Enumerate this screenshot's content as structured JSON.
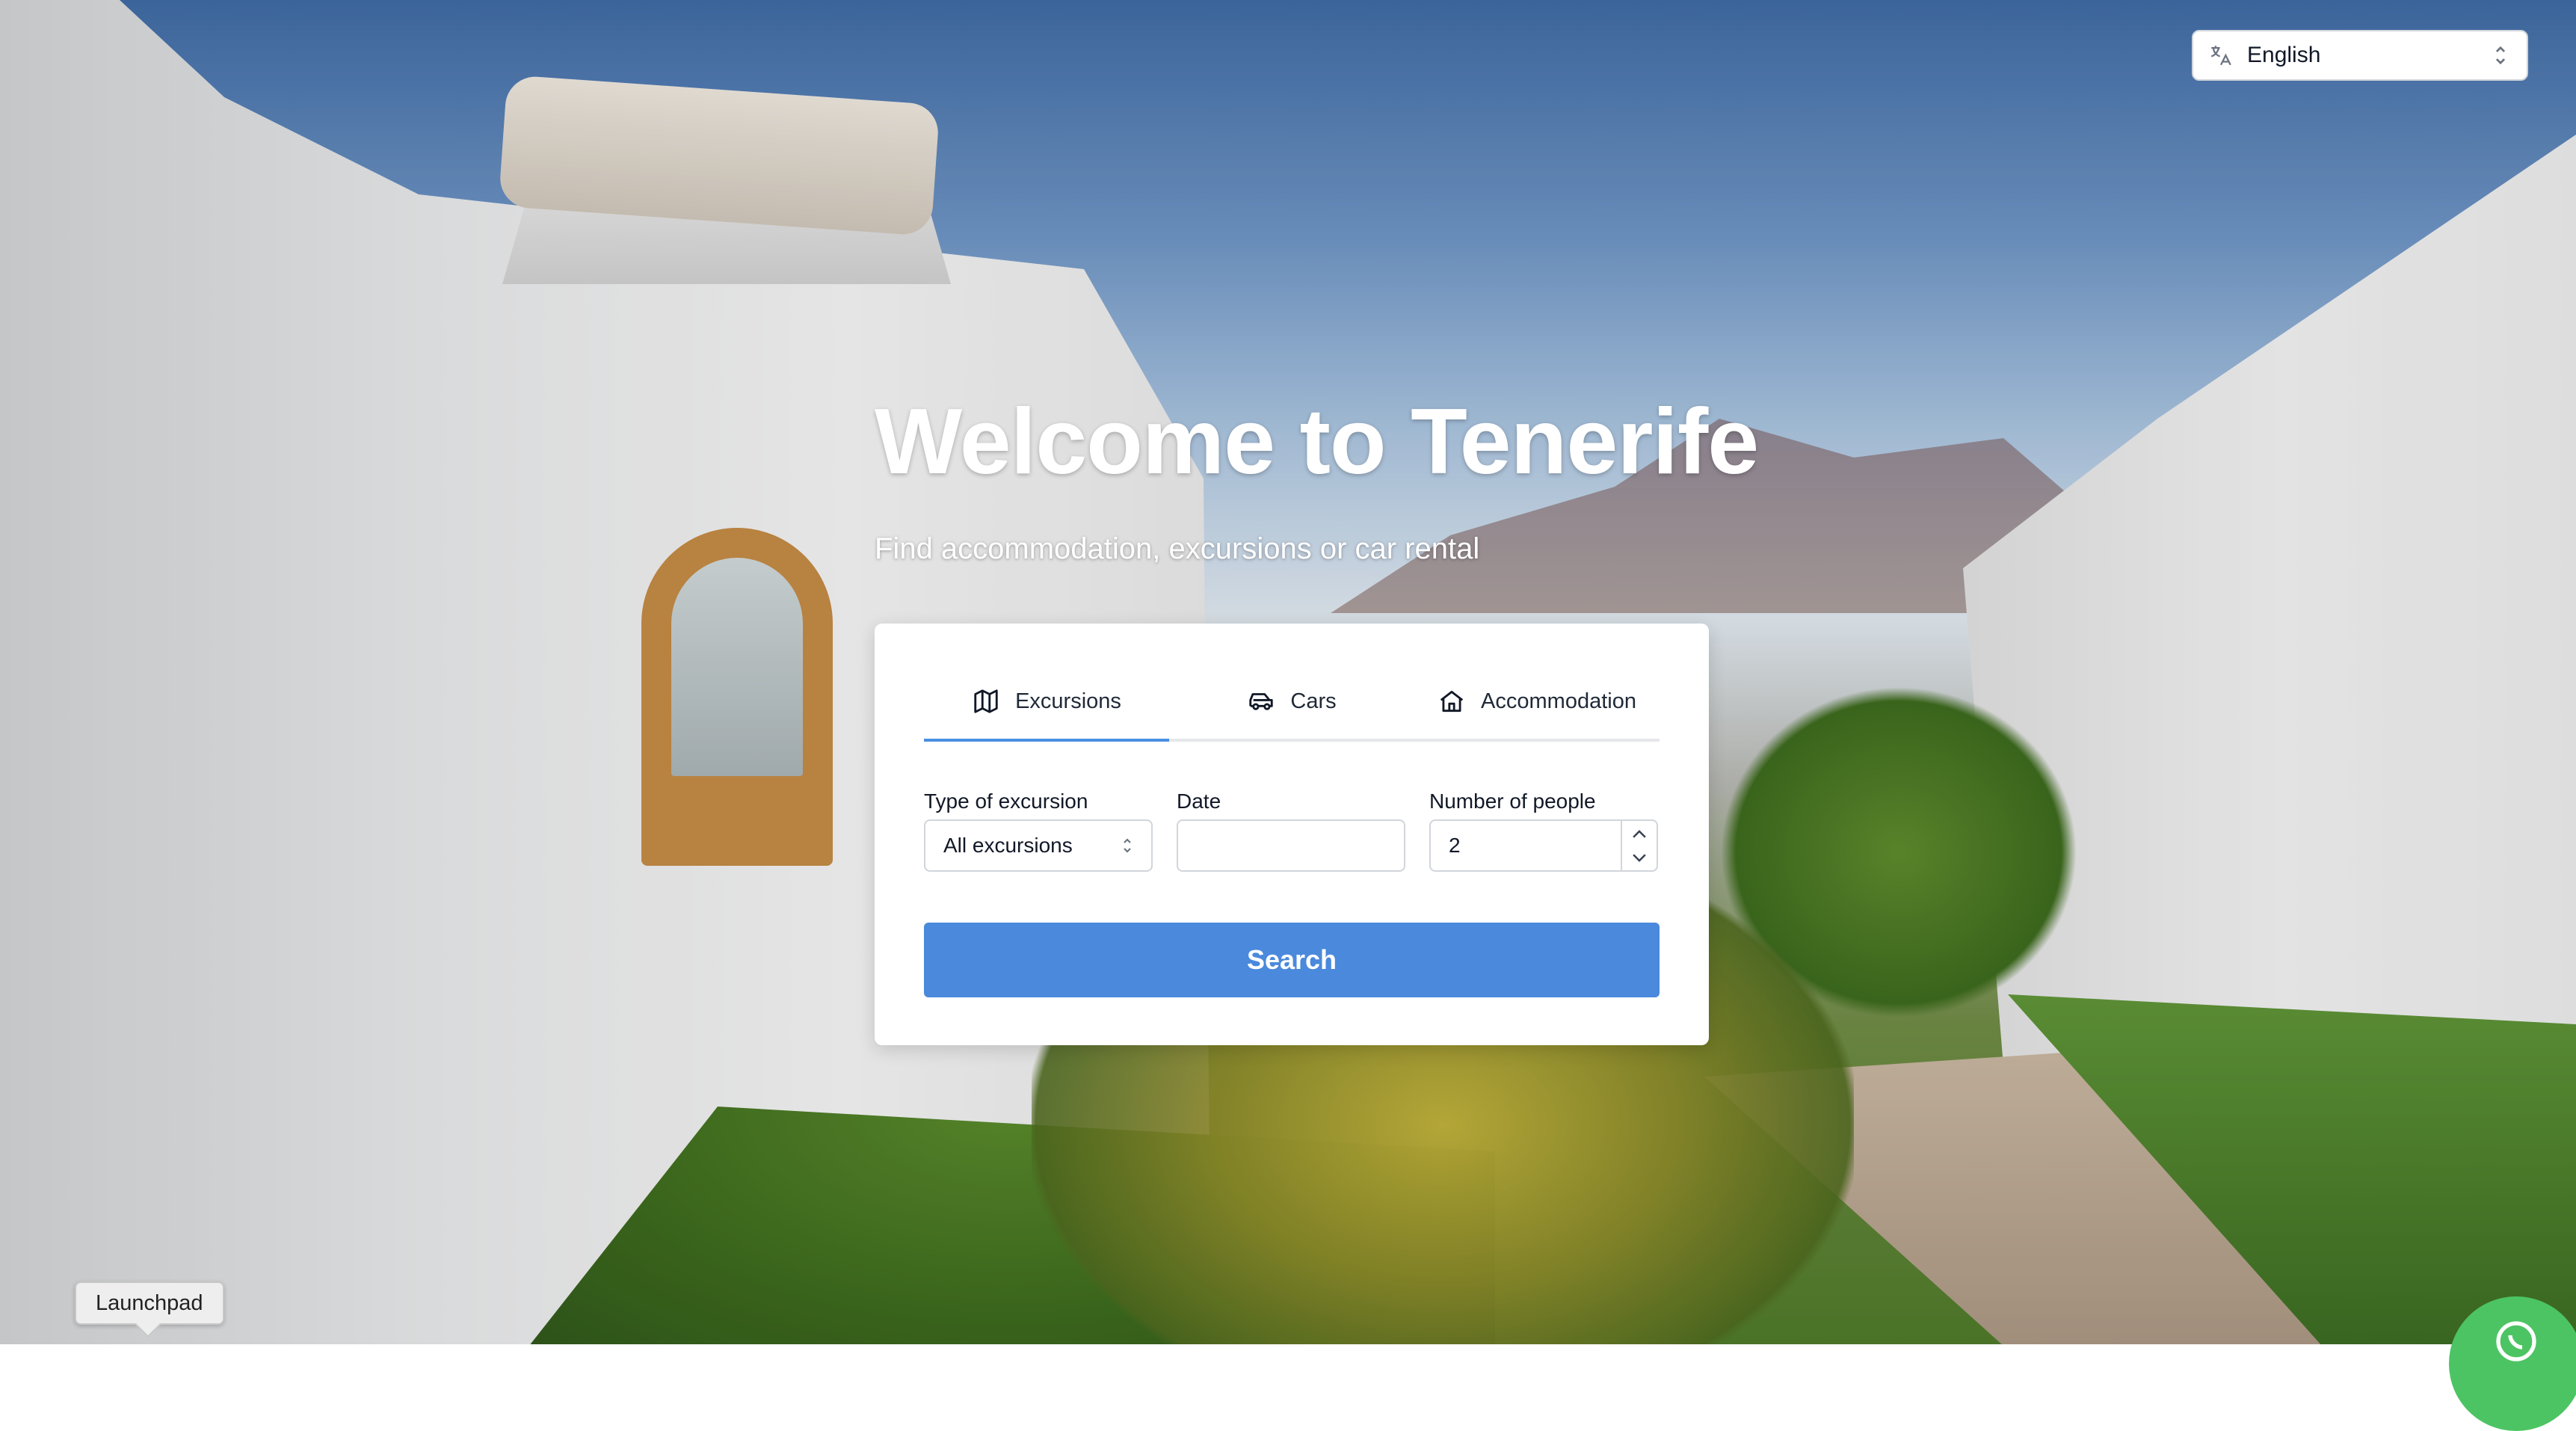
{
  "language": {
    "selected": "English"
  },
  "hero": {
    "title": "Welcome to Tenerife",
    "subtitle": "Find accommodation, excursions or car rental"
  },
  "tabs": [
    {
      "label": "Excursions",
      "icon": "map-icon",
      "active": true
    },
    {
      "label": "Cars",
      "icon": "car-icon",
      "active": false
    },
    {
      "label": "Accommodation",
      "icon": "home-icon",
      "active": false
    }
  ],
  "form": {
    "type_label": "Type of excursion",
    "type_value": "All excursions",
    "date_label": "Date",
    "date_value": "",
    "people_label": "Number of people",
    "people_value": "2",
    "search_label": "Search"
  },
  "launchpad": {
    "label": "Launchpad"
  },
  "colors": {
    "accent": "#4a89dc",
    "tab_underline": "#4a90e2",
    "chat": "#4cc463"
  }
}
